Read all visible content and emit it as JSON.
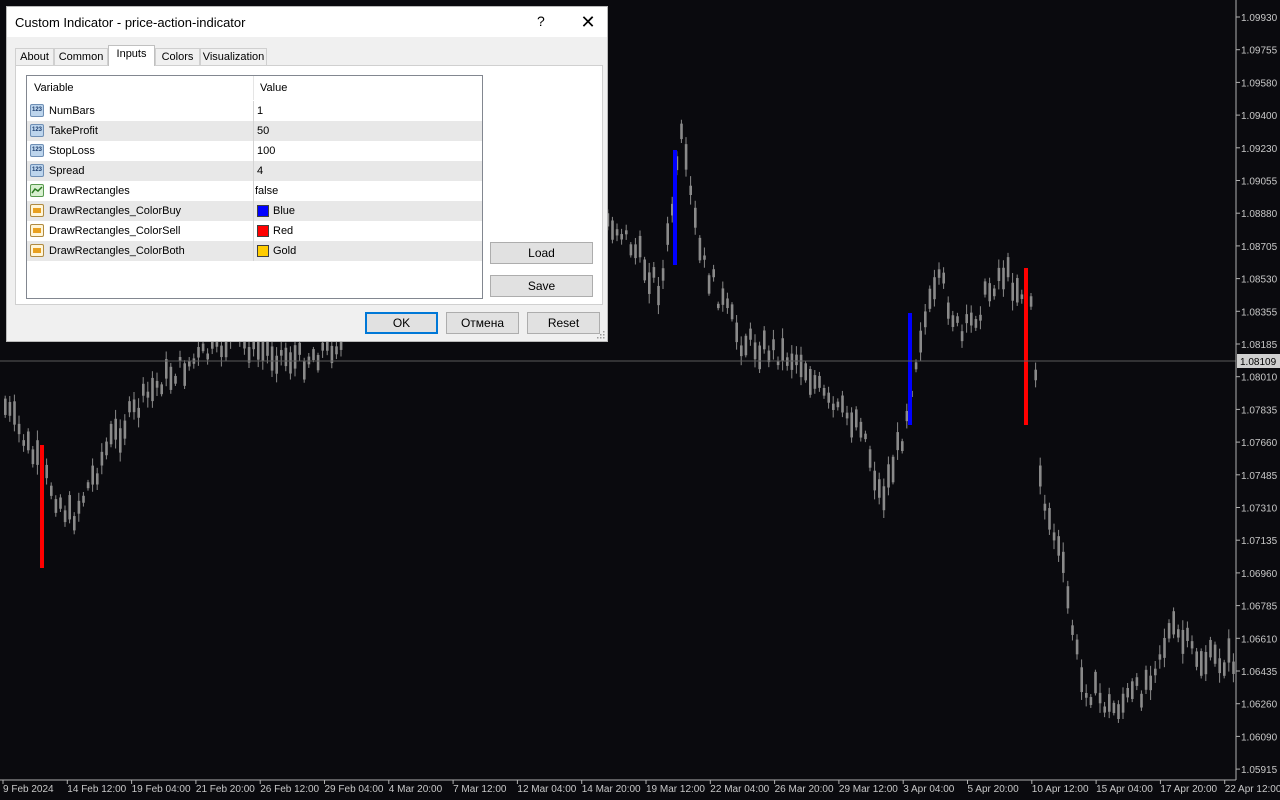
{
  "dialog": {
    "title": "Custom Indicator - price-action-indicator",
    "help_label": "?",
    "close_label": "✕",
    "tabs": [
      {
        "label": "About"
      },
      {
        "label": "Common"
      },
      {
        "label": "Inputs"
      },
      {
        "label": "Colors"
      },
      {
        "label": "Visualization"
      }
    ],
    "active_tab": "Inputs",
    "table": {
      "columns": [
        "Variable",
        "Value"
      ],
      "rows": [
        {
          "name": "NumBars",
          "value": "1",
          "type_icon": "integer-type-icon"
        },
        {
          "name": "TakeProfit",
          "value": "50",
          "type_icon": "integer-type-icon"
        },
        {
          "name": "StopLoss",
          "value": "100",
          "type_icon": "integer-type-icon"
        },
        {
          "name": "Spread",
          "value": "4",
          "type_icon": "integer-type-icon"
        },
        {
          "name": "DrawRectangles",
          "value": "false",
          "type_icon": "boolean-type-icon"
        },
        {
          "name": "DrawRectangles_ColorBuy",
          "value": "Blue",
          "swatch": "#0000ff",
          "type_icon": "color-type-icon"
        },
        {
          "name": "DrawRectangles_ColorSell",
          "value": "Red",
          "swatch": "#ff0000",
          "type_icon": "color-type-icon"
        },
        {
          "name": "DrawRectangles_ColorBoth",
          "value": "Gold",
          "swatch": "#ffcc00",
          "type_icon": "color-type-icon"
        }
      ]
    },
    "buttons": {
      "load": "Load",
      "save": "Save",
      "ok": "OK",
      "cancel": "Отмена",
      "reset": "Reset"
    }
  },
  "chart": {
    "price_labels": [
      "1.09930",
      "1.09755",
      "1.09580",
      "1.09400",
      "1.09230",
      "1.09055",
      "1.08880",
      "1.08705",
      "1.08530",
      "1.08355",
      "1.08185",
      "1.08010",
      "1.07835",
      "1.07660",
      "1.07485",
      "1.07310",
      "1.07135",
      "1.06960",
      "1.06785",
      "1.06610",
      "1.06435",
      "1.06260",
      "1.06090",
      "1.05915"
    ],
    "current_price": "1.08109",
    "time_labels": [
      "9 Feb 2024",
      "14 Feb 12:00",
      "19 Feb 04:00",
      "21 Feb 20:00",
      "26 Feb 12:00",
      "29 Feb 04:00",
      "4 Mar 20:00",
      "7 Mar 12:00",
      "12 Mar 04:00",
      "14 Mar 20:00",
      "19 Mar 12:00",
      "22 Mar 04:00",
      "26 Mar 20:00",
      "29 Mar 12:00",
      "3 Apr 04:00",
      "5 Apr 20:00",
      "10 Apr 12:00",
      "15 Apr 04:00",
      "17 Apr 20:00",
      "22 Apr 12:00"
    ],
    "colors": {
      "candle": "#8a8a8a",
      "background": "#0a0a0e",
      "buy": "#0000ff",
      "sell": "#ff0000",
      "axis_text": "#c8c8c8"
    }
  }
}
